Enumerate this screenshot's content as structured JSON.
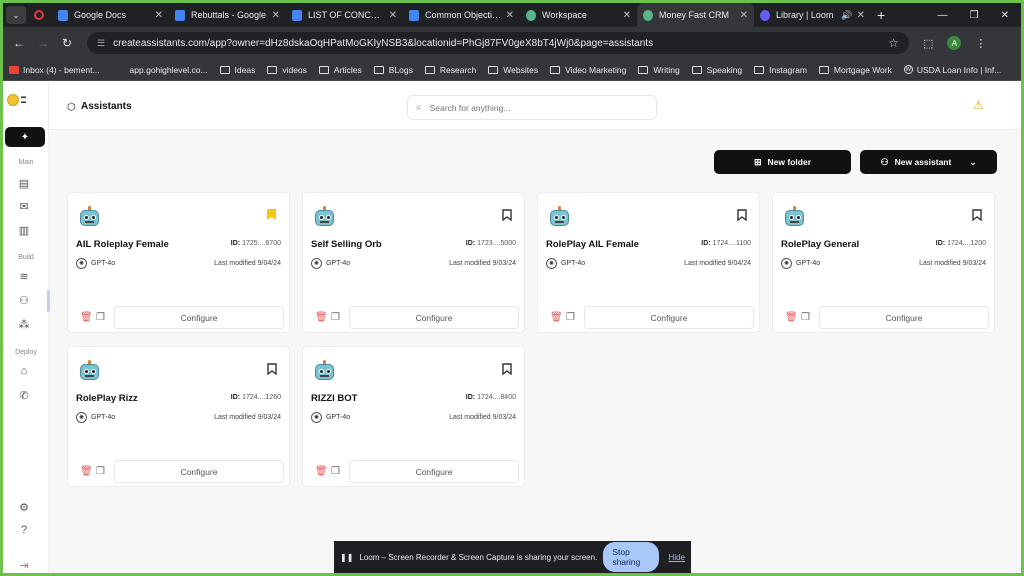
{
  "browser": {
    "tabs": [
      {
        "title": "Google Docs",
        "icon": "docs-icon",
        "color": "#4285f4"
      },
      {
        "title": "Rebuttals - Google",
        "icon": "docs-icon",
        "color": "#4285f4"
      },
      {
        "title": "LIST OF CONCERNS",
        "icon": "docs-icon",
        "color": "#4285f4"
      },
      {
        "title": "Common Objection",
        "icon": "docs-icon",
        "color": "#4285f4"
      },
      {
        "title": "Workspace",
        "icon": "workspace-icon",
        "color": "#57b38a"
      },
      {
        "title": "Money Fast CRM",
        "icon": "crm-icon",
        "color": "#57b38a"
      },
      {
        "title": "Library | Loom",
        "icon": "loom-icon",
        "color": "#625df5"
      }
    ],
    "url": "createassistants.com/app?owner=dHz8dskaOqHPatMoGKIyNSB3&locationid=PhGj87FV0geX8bT4jWj0&page=assistants",
    "profile_initial": "A",
    "bookmarks": [
      {
        "label": "Inbox (4) - bement...",
        "icon": "gmail-icon"
      },
      {
        "label": "app.gohighlevel.co...",
        "icon": "link-icon"
      },
      {
        "label": "Ideas",
        "icon": "folder-icon"
      },
      {
        "label": "videos",
        "icon": "folder-icon"
      },
      {
        "label": "Articles",
        "icon": "folder-icon"
      },
      {
        "label": "BLogs",
        "icon": "folder-icon"
      },
      {
        "label": "Research",
        "icon": "folder-icon"
      },
      {
        "label": "Websites",
        "icon": "folder-icon"
      },
      {
        "label": "Video Marketing",
        "icon": "folder-icon"
      },
      {
        "label": "Writing",
        "icon": "folder-icon"
      },
      {
        "label": "Speaking",
        "icon": "folder-icon"
      },
      {
        "label": "Instagram",
        "icon": "folder-icon"
      },
      {
        "label": "Mortgage Work",
        "icon": "folder-icon"
      },
      {
        "label": "USDA Loan Info | Inf...",
        "icon": "wordpress-icon"
      }
    ]
  },
  "sidebar": {
    "sections": {
      "main": "Main",
      "build": "Build",
      "deploy": "Deploy"
    }
  },
  "header": {
    "title": "Assistants",
    "search_placeholder": "Search for anything..."
  },
  "toolbar": {
    "new_folder": "New folder",
    "new_assistant": "New assistant"
  },
  "cards": [
    {
      "name": "AIL Roleplay Female",
      "id_label": "ID:",
      "id": "1725....8700",
      "model": "GPT-4o",
      "modified": "Last modified 9/04/24",
      "bookmarked": true,
      "configure": "Configure"
    },
    {
      "name": "Self Selling Orb",
      "id_label": "ID:",
      "id": "1723....5000",
      "model": "GPT-4o",
      "modified": "Last modified 9/03/24",
      "bookmarked": false,
      "configure": "Configure"
    },
    {
      "name": "RolePlay AIL Female",
      "id_label": "ID:",
      "id": "1724....1100",
      "model": "GPT-4o",
      "modified": "Last modified 9/04/24",
      "bookmarked": false,
      "configure": "Configure"
    },
    {
      "name": "RolePlay General",
      "id_label": "ID:",
      "id": "1724....1200",
      "model": "GPT-4o",
      "modified": "Last modified 9/03/24",
      "bookmarked": false,
      "configure": "Configure"
    },
    {
      "name": "RolePlay Rizz",
      "id_label": "ID:",
      "id": "1724....1260",
      "model": "GPT-4o",
      "modified": "Last modified 9/03/24",
      "bookmarked": false,
      "configure": "Configure"
    },
    {
      "name": "RIZZI BOT",
      "id_label": "ID:",
      "id": "1724....8400",
      "model": "GPT-4o",
      "modified": "Last modified 9/03/24",
      "bookmarked": false,
      "configure": "Configure"
    }
  ],
  "loom": {
    "message": "Loom – Screen Recorder & Screen Capture is sharing your screen.",
    "stop": "Stop sharing",
    "hide": "Hide"
  },
  "colors": {
    "accent_dark": "#111111",
    "bookmark_active": "#f5c518",
    "danger": "#e05a5a"
  }
}
